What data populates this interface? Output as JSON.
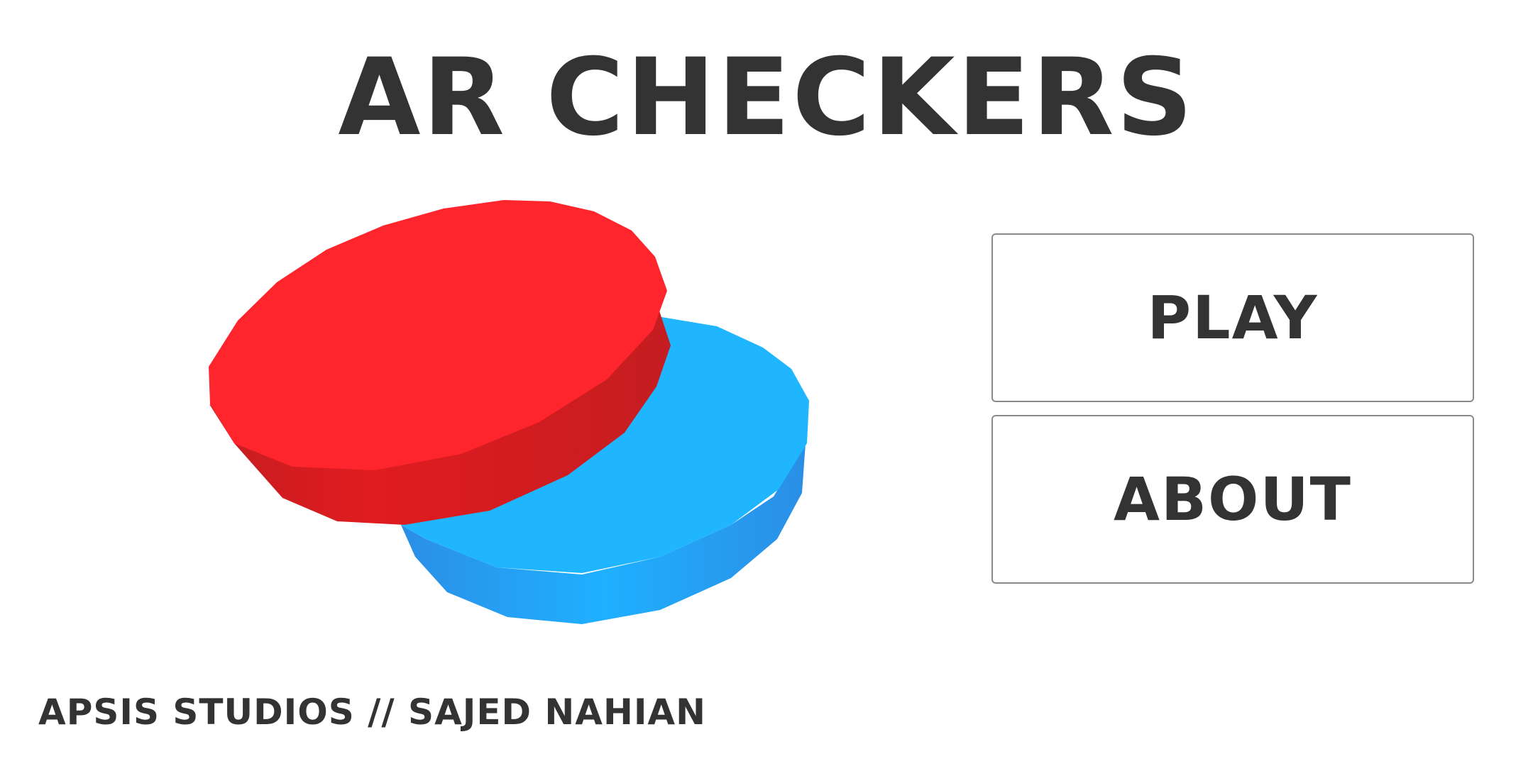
{
  "app": {
    "title": "AR CHECKERS"
  },
  "menu": {
    "play_label": "PLAY",
    "about_label": "ABOUT"
  },
  "footer": {
    "credit": "APSIS STUDIOS // SAJED NAHIAN"
  },
  "colors": {
    "text": "#333333",
    "background": "#ffffff",
    "button_border": "#8a8a8a",
    "red_checker_top": "#ff252d",
    "red_checker_side": "#e01c1f",
    "blue_checker_top": "#1fb6ff",
    "blue_checker_side": "#209ef0"
  },
  "icons": {
    "hero": "checker-pieces-illustration"
  }
}
